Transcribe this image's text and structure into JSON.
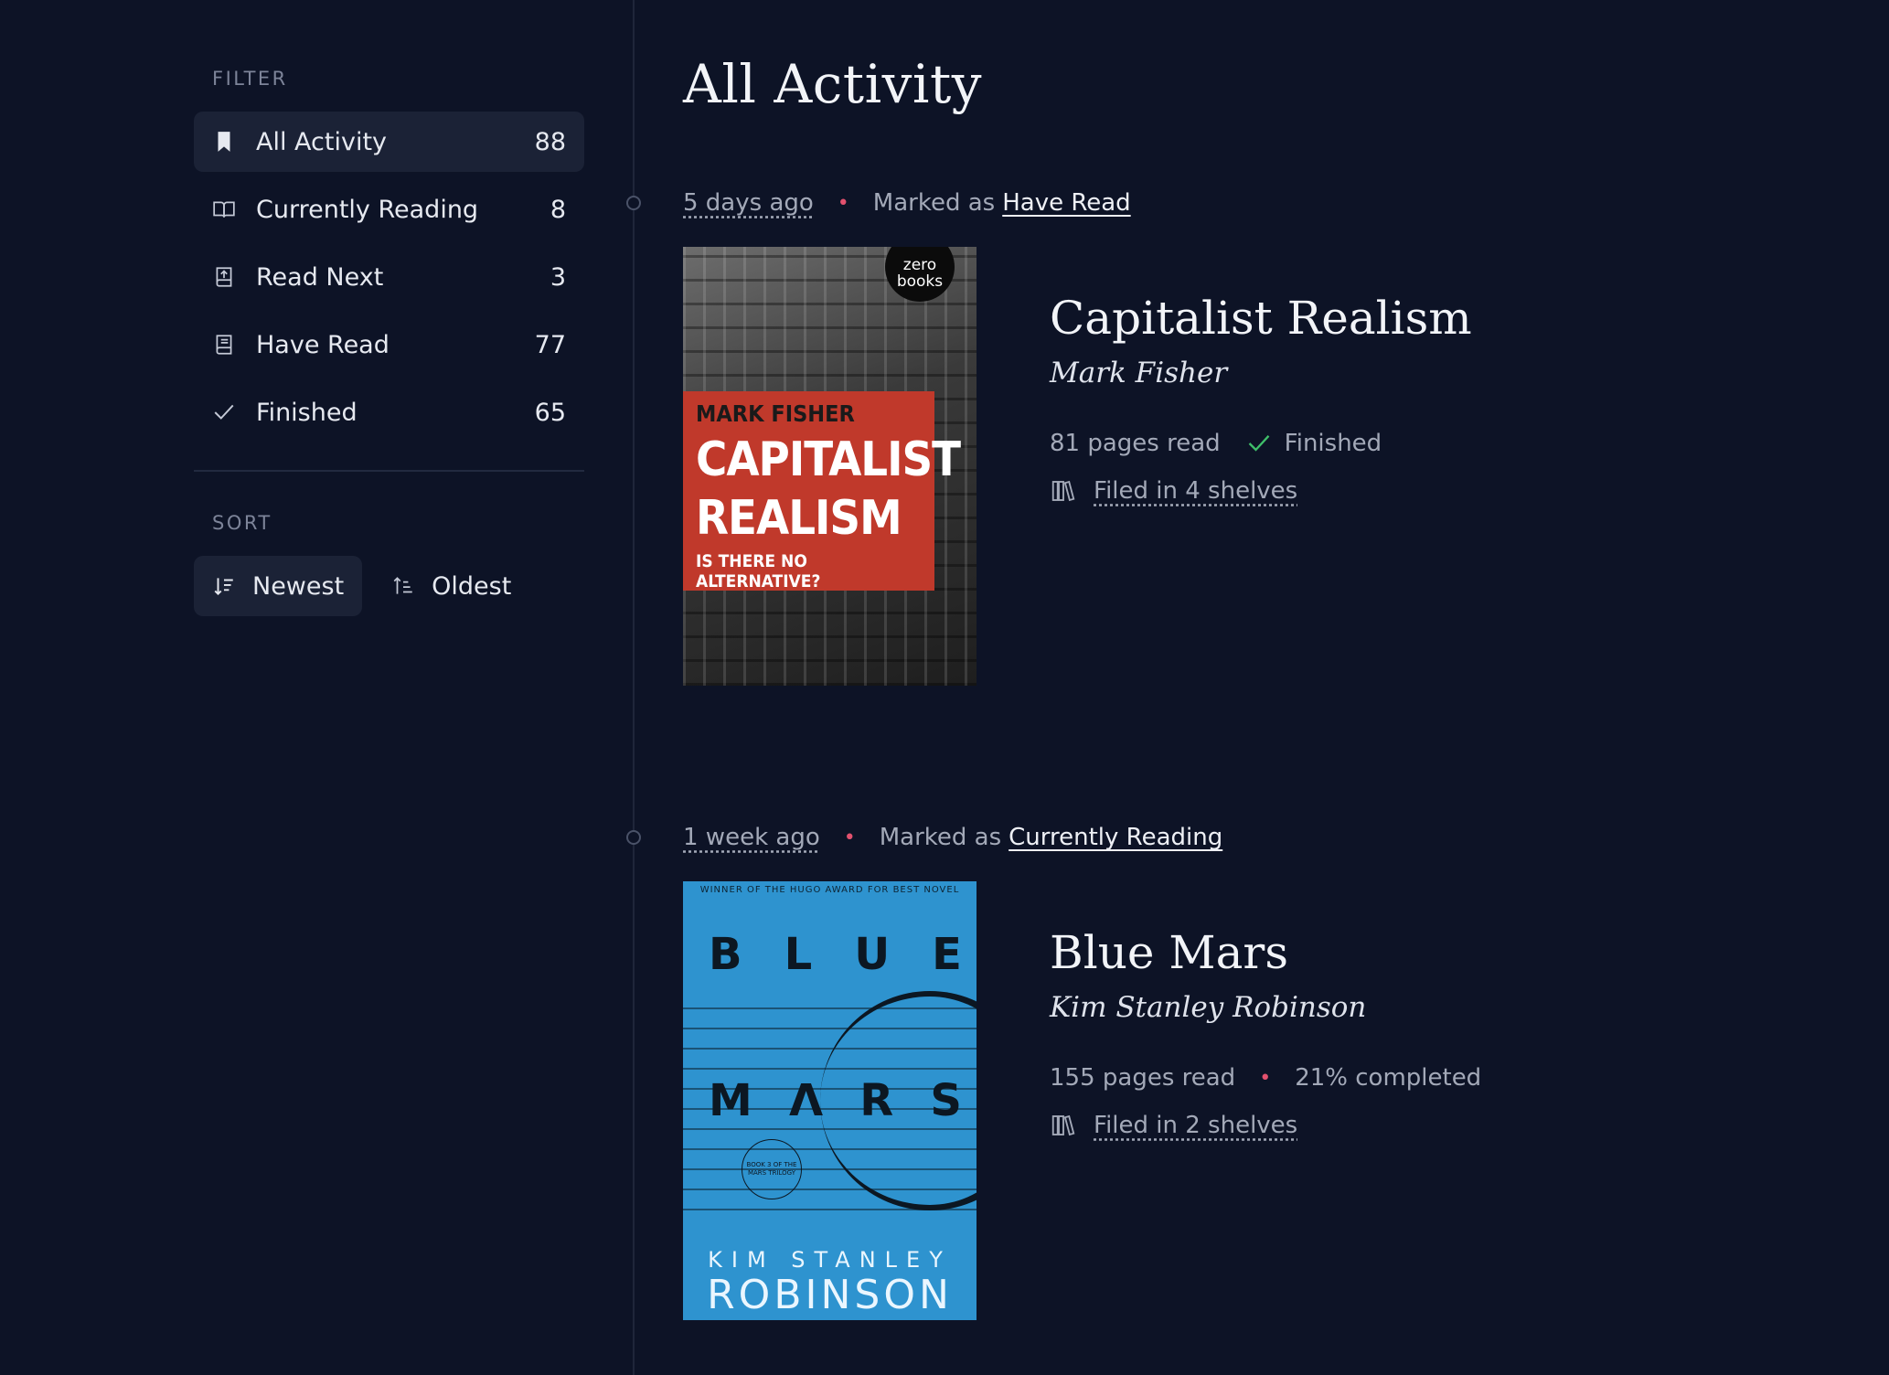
{
  "sidebar": {
    "filter_label": "FILTER",
    "items": [
      {
        "label": "All Activity",
        "count": "88"
      },
      {
        "label": "Currently Reading",
        "count": "8"
      },
      {
        "label": "Read Next",
        "count": "3"
      },
      {
        "label": "Have Read",
        "count": "77"
      },
      {
        "label": "Finished",
        "count": "65"
      }
    ],
    "sort_label": "SORT",
    "sort": {
      "newest": "Newest",
      "oldest": "Oldest"
    }
  },
  "main": {
    "title": "All Activity",
    "entries": [
      {
        "time": "5 days ago",
        "marked_as": "Marked as",
        "status": "Have Read",
        "book_title": "Capitalist Realism",
        "author": "Mark Fisher",
        "pages": "81 pages read",
        "state": "Finished",
        "shelves": "Filed in 4 shelves",
        "cover": {
          "publisher_line1": "zero",
          "publisher_line2": "books",
          "author": "MARK FISHER",
          "title_line1": "CAPITALIST",
          "title_line2": "REALISM",
          "subtitle": "IS THERE NO ALTERNATIVE?"
        }
      },
      {
        "time": "1 week ago",
        "marked_as": "Marked as",
        "status": "Currently Reading",
        "book_title": "Blue Mars",
        "author": "Kim Stanley Robinson",
        "pages": "155 pages read",
        "progress": "21% completed",
        "shelves": "Filed in 2 shelves",
        "cover": {
          "award": "WINNER OF THE HUGO AWARD FOR BEST NOVEL",
          "word1": [
            "B",
            "L",
            "U",
            "E"
          ],
          "word2": [
            "M",
            "Λ",
            "R",
            "S"
          ],
          "badge": "BOOK 3 OF THE MARS TRILOGY",
          "author_line1": "KIM STANLEY",
          "author_line2": "ROBINSON"
        }
      }
    ]
  },
  "colors": {
    "background": "#0d1326",
    "active": "#1b2236",
    "accent_dot": "#e2516e",
    "check": "#3fbf6a"
  }
}
